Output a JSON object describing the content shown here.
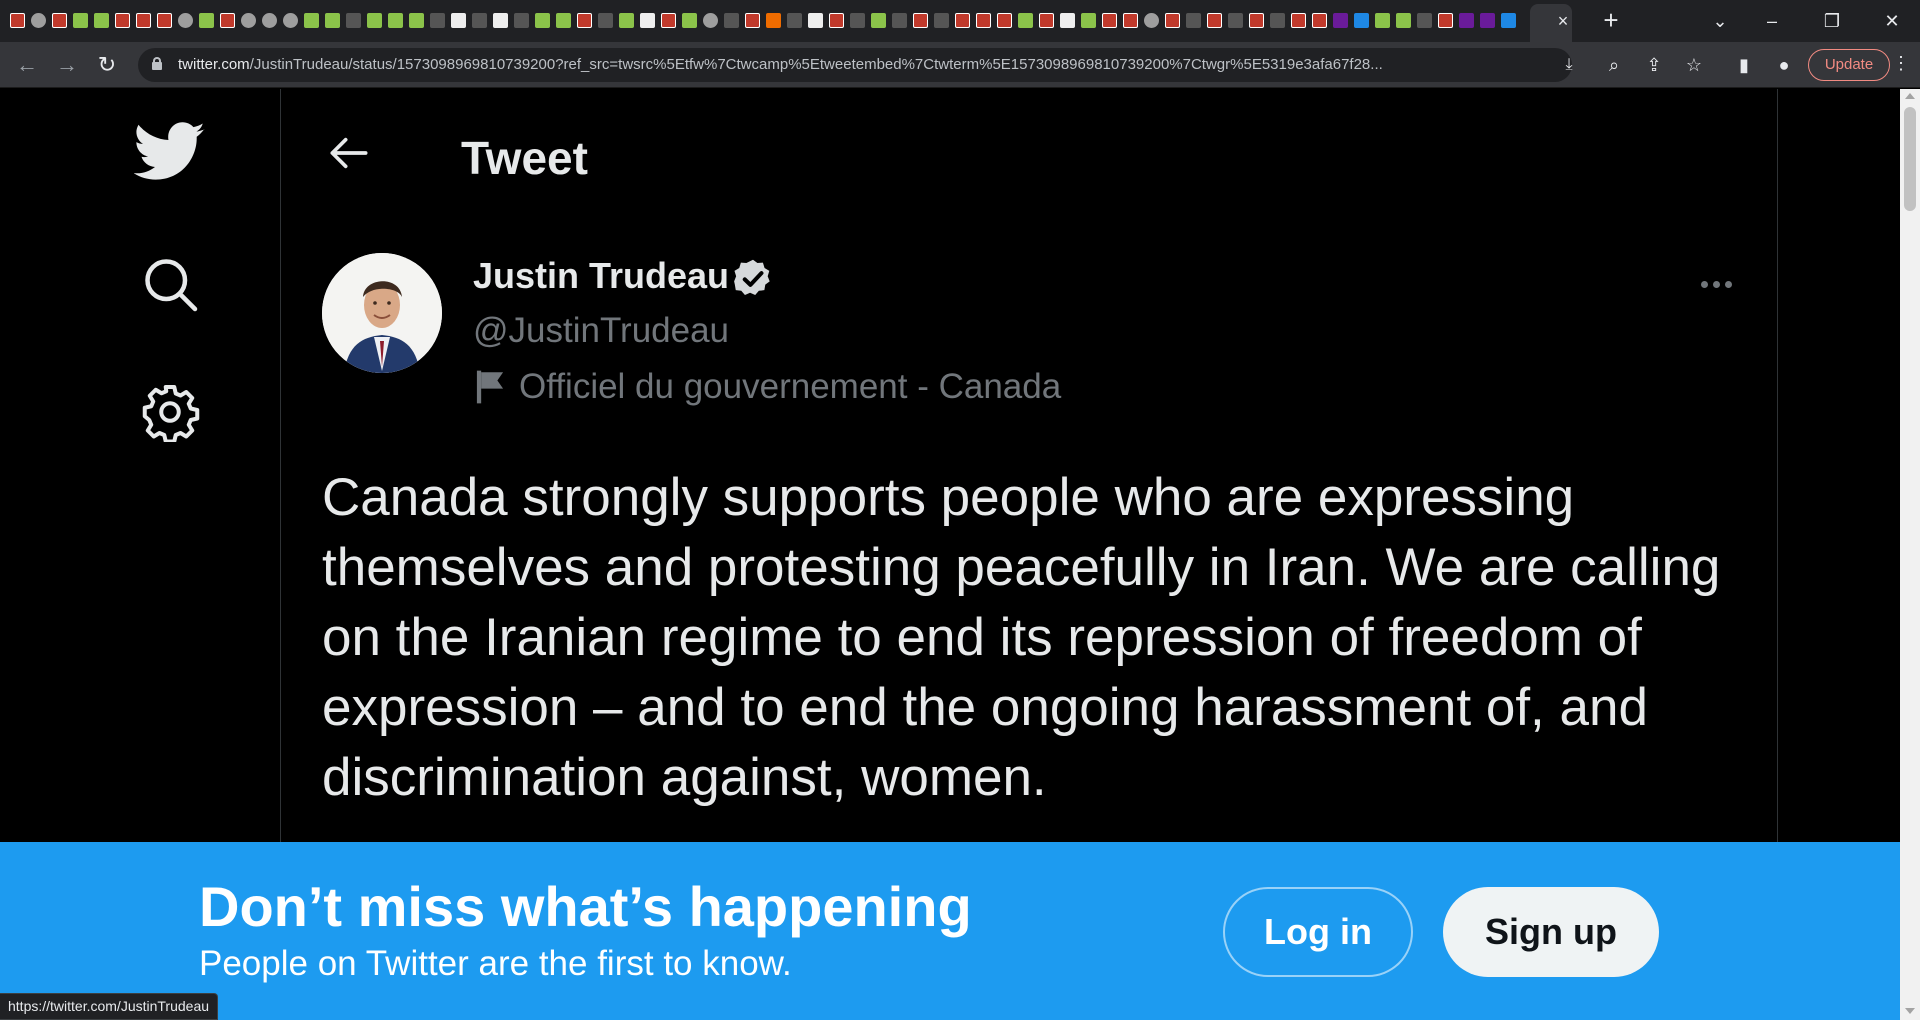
{
  "browser": {
    "tabs_active_close": "×",
    "new_tab": "+",
    "url_host": "twitter.com",
    "url_path": "/JustinTrudeau/status/1573098969810739200?ref_src=twsrc%5Etfw%7Ctwcamp%5Etweetembed%7Ctwterm%5E1573098969810739200%7Ctwgr%5E5319e3afa67f28...",
    "update_label": "Update",
    "status_url": "https://twitter.com/JustinTrudeau"
  },
  "sidebar": {
    "items": [
      {
        "name": "twitter-logo-icon"
      },
      {
        "name": "search-icon"
      },
      {
        "name": "settings-icon"
      }
    ]
  },
  "header": {
    "title": "Tweet"
  },
  "tweet": {
    "author_name": "Justin Trudeau",
    "handle": "@JustinTrudeau",
    "label": "Officiel du gouvernement - Canada",
    "text": "Canada strongly supports people who are expressing themselves and protesting peacefully in Iran. We are calling on the Iranian regime to end its repression of freedom of expression – and to end the ongoing harassment of, and discrimination against, women."
  },
  "banner": {
    "title": "Don’t miss what’s happening",
    "subtitle": "People on Twitter are the first to know.",
    "login_label": "Log in",
    "signup_label": "Sign up"
  },
  "colors": {
    "accent": "#1d9bf0",
    "background": "#000000",
    "text_primary": "#e7e9ea",
    "text_secondary": "#71767b"
  }
}
